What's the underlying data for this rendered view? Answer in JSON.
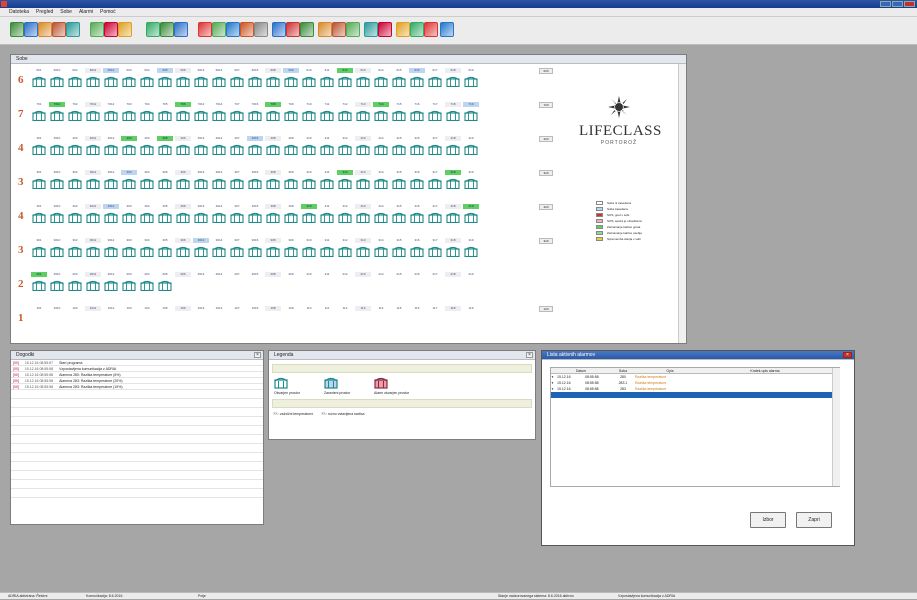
{
  "window": {
    "title": ""
  },
  "menu": [
    "Datoteka",
    "Pregled",
    "Sobe",
    "Alarmi",
    "Pomoć"
  ],
  "toolbar": {
    "icon_colors": [
      "#3a8a3a",
      "#2a6fc9",
      "#d88a2a",
      "#b53",
      "#2a9a9a",
      "#5a5",
      "#c03",
      "#e0a020",
      "#3a6",
      "#3a8a3a",
      "#2a6fc9",
      "#d33",
      "#5a5",
      "#27c",
      "#c52",
      "#888",
      "#2a6fc9",
      "#c33",
      "#3a8a3a",
      "#d88a2a",
      "#b53",
      "#5a5",
      "#2a9a9a",
      "#c03",
      "#e0a020",
      "#3a6",
      "#d33",
      "#27c"
    ]
  },
  "room_panel": {
    "title": "Sobe",
    "floors": [
      {
        "floor": "6",
        "numbers": [
          "601",
          "6010",
          "602",
          "6011",
          "6012",
          "603",
          "604",
          "605",
          "606",
          "6013",
          "6014",
          "607",
          "6015",
          "608",
          "609",
          "610",
          "611",
          "612",
          "613",
          "614",
          "615",
          "616",
          "617",
          "618",
          "619"
        ],
        "highlight": {
          "4": "blue",
          "7": "blue",
          "14": "blue",
          "17": "green",
          "21": "blue"
        },
        "extra": "620"
      },
      {
        "floor": "7",
        "numbers": [
          "701",
          "7010",
          "702",
          "7011",
          "7012",
          "703",
          "704",
          "705",
          "706",
          "7013",
          "7014",
          "707",
          "7015",
          "708",
          "709",
          "710",
          "711",
          "712",
          "713",
          "714",
          "715",
          "716",
          "717",
          "718",
          "719"
        ],
        "highlight": {
          "1": "green",
          "8": "green",
          "13": "green",
          "19": "green",
          "24": "blue"
        },
        "extra": "720"
      },
      {
        "floor": "4",
        "numbers": [
          "401",
          "4010",
          "402",
          "4011",
          "4012",
          "403",
          "404",
          "405",
          "406",
          "4013",
          "4014",
          "407",
          "4015",
          "408",
          "409",
          "410",
          "411",
          "412",
          "413",
          "414",
          "415",
          "416",
          "417",
          "418",
          "419"
        ],
        "highlight": {
          "5": "green",
          "7": "green",
          "12": "blue"
        },
        "extra": "420"
      },
      {
        "floor": "3",
        "numbers": [
          "301",
          "3010",
          "302",
          "3011",
          "3012",
          "303",
          "304",
          "305",
          "306",
          "3013",
          "3014",
          "307",
          "3015",
          "308",
          "309",
          "310",
          "311",
          "312",
          "313",
          "314",
          "315",
          "316",
          "317",
          "318",
          "319"
        ],
        "highlight": {
          "5": "blue",
          "17": "green",
          "23": "green"
        },
        "extra": "320"
      },
      {
        "floor": "4",
        "numbers": [
          "401",
          "4010",
          "402",
          "4011",
          "4012",
          "403",
          "404",
          "405",
          "406",
          "4013",
          "4014",
          "407",
          "4015",
          "408",
          "409",
          "410",
          "411",
          "412",
          "413",
          "414",
          "415",
          "416",
          "417",
          "418",
          "419"
        ],
        "highlight": {
          "4": "blue",
          "15": "green",
          "24": "green"
        },
        "extra": "420"
      },
      {
        "floor": "3",
        "numbers": [
          "301",
          "3010",
          "302",
          "3011",
          "3012",
          "303",
          "304",
          "305",
          "306",
          "3013",
          "3014",
          "307",
          "3015",
          "308",
          "309",
          "310",
          "311",
          "312",
          "313",
          "314",
          "315",
          "316",
          "317",
          "318",
          "319"
        ],
        "highlight": {
          "9": "blue"
        },
        "extra": "320"
      },
      {
        "floor": "2",
        "numbers": [
          "201",
          "2010",
          "202",
          "2011",
          "2012",
          "203",
          "204",
          "205",
          "206",
          "2013",
          "2014",
          "207",
          "2015",
          "208",
          "209",
          "210",
          "211",
          "212",
          "213",
          "214",
          "215",
          "216",
          "217",
          "218",
          "219"
        ],
        "highlight": {
          "0": "green"
        },
        "extra": "",
        "short": 8
      },
      {
        "floor": "1",
        "numbers": [
          "101",
          "1010",
          "102",
          "1011",
          "1012",
          "103",
          "104",
          "105",
          "106",
          "1013",
          "1014",
          "107",
          "1015",
          "108",
          "109",
          "110",
          "111",
          "112",
          "113",
          "114",
          "115",
          "116",
          "117",
          "118",
          "119"
        ],
        "highlight": {},
        "extra": "120",
        "numbers_only": true
      }
    ],
    "logo_main": "LIFECLASS",
    "logo_sub": "PORTOROŽ",
    "legend": [
      {
        "color": "#ffffff",
        "label": "Soba ni zasedena"
      },
      {
        "color": "#bcd6f2",
        "label": "Soba zasedena"
      },
      {
        "color": "#d03030",
        "label": "SOS, gost v sobi"
      },
      {
        "color": "#f0b0b0",
        "label": "SOS, sestra je obveščena"
      },
      {
        "color": "#5fcf65",
        "label": "Zaznavanje kartice gosta"
      },
      {
        "color": "#9ad0a0",
        "label": "Zaznavanje kartice osebja"
      },
      {
        "color": "#e8d040",
        "label": "Sprememba stanja v sobi"
      }
    ]
  },
  "events_panel": {
    "title": "Dogodki",
    "rows": [
      {
        "code": "[00]",
        "time": "15.12.16 08:55:57",
        "text": "Start programa"
      },
      {
        "code": "[00]",
        "time": "15.12.16 08:55:58",
        "text": "Vzpostavljena komunikacija z ADRIA"
      },
      {
        "code": "[00]",
        "time": "15.12.16 08:55:58",
        "text": "Alarmna 280: Razlika temperature (6%)"
      },
      {
        "code": "[00]",
        "time": "15.12.16 08:55:58",
        "text": "Alarmna 283: Razlika temperature (20%)"
      },
      {
        "code": "[00]",
        "time": "15.12.16 08:55:58",
        "text": "Alarmna 283: Razlika temperature (19%)"
      }
    ]
  },
  "legend_panel": {
    "title": "Legenda",
    "items": [
      "Okvarjen prostor",
      "Zasedeni prostor",
      "Alarm okvarjen prostor"
    ],
    "footer": [
      "??:: vzdolžni temperaturni",
      "??:: ročno vstavljena kartica"
    ]
  },
  "alarms_panel": {
    "title": "Lista aktivnih alarmov",
    "columns": [
      "Datum",
      "Soba",
      "Opis",
      "Kratek opis alarma"
    ],
    "rows": [
      {
        "date": "15.12.16",
        "time": "08:55:58",
        "room": "280",
        "desc": "Razlika temperature"
      },
      {
        "date": "15.12.16",
        "time": "08:55:58",
        "room": "283.1",
        "desc": "Razlika temperature"
      },
      {
        "date": "15.12.16",
        "time": "08:55:58",
        "room": "283",
        "desc": "Razlika temperature"
      }
    ],
    "btn_yes": "Izbor",
    "btn_close": "Zapri"
  },
  "statusbar": [
    "ADRIA aktivirana: Řešení",
    "Komunikacija: 8.6.2016",
    "Polje",
    "Stanje nadzorovanega sistema: 8.6.2016 aktivno",
    "Vzpostavljena komunikacija z ADRIA"
  ]
}
